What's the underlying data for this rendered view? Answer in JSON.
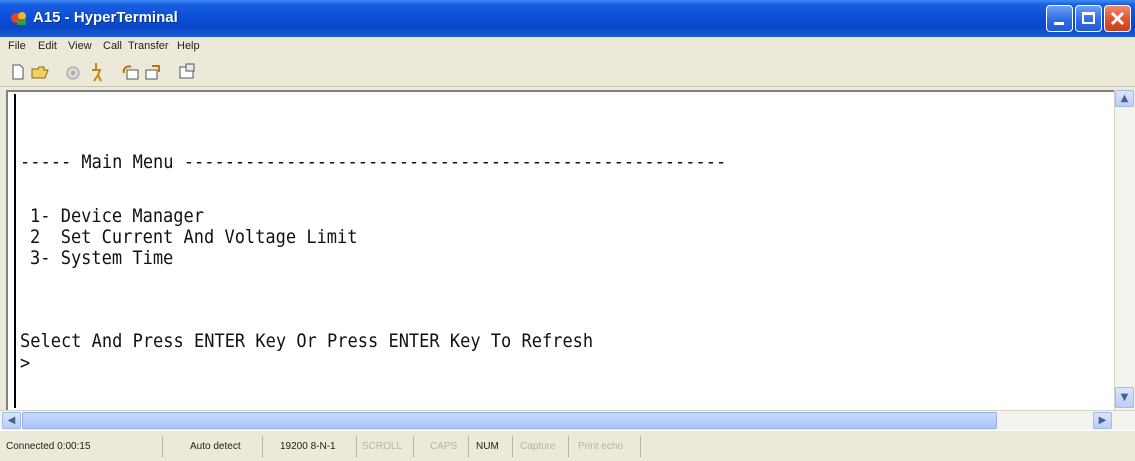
{
  "window": {
    "title": "A15 - HyperTerminal"
  },
  "menu": [
    "File",
    "Edit",
    "View",
    "Call",
    "Transfer",
    "Help"
  ],
  "toolbar": {
    "icons": [
      "new-icon",
      "open-icon",
      "call-icon",
      "disconnect-icon",
      "send-icon",
      "receive-icon",
      "properties-icon"
    ]
  },
  "terminal": {
    "lines": [
      "----- Main Menu -----------------------------------------------------",
      "1- Device Manager",
      "2  Set Current And Voltage Limit",
      "3- System Time",
      "Select And Press ENTER Key Or Press ENTER Key To Refresh",
      ">"
    ]
  },
  "status": {
    "connected": "Connected 0:00:15",
    "detect": "Auto detect",
    "port": "19200 8-N-1",
    "scroll": "SCROLL",
    "caps": "CAPS",
    "num": "NUM",
    "capture": "Capture",
    "print_echo": "Print echo"
  }
}
